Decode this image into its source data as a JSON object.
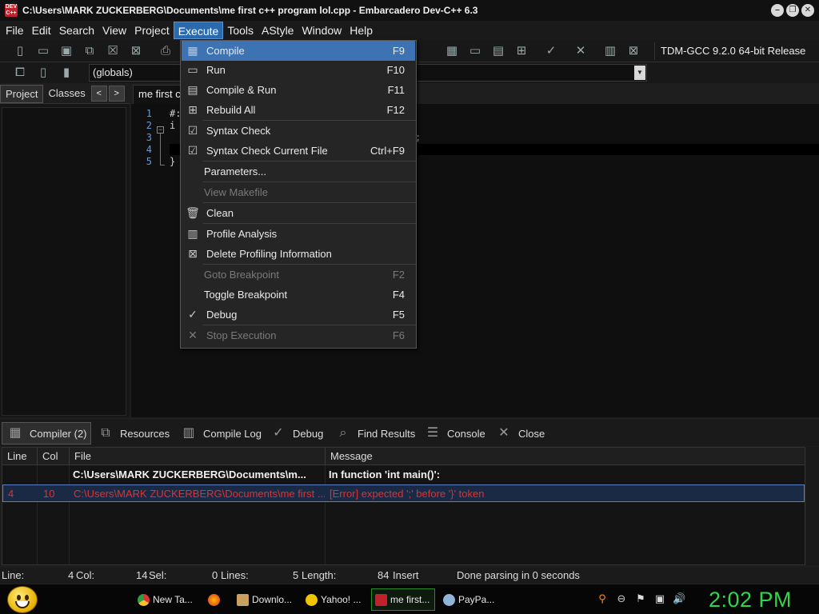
{
  "window": {
    "title": "C:\\Users\\MARK ZUCKERBERG\\Documents\\me first c++ program lol.cpp - Embarcadero Dev-C++ 6.3",
    "app_icon_text": "DEV C++",
    "controls": {
      "minimize": "–",
      "restore": "❐",
      "close": "✕"
    }
  },
  "menubar": {
    "items": [
      "File",
      "Edit",
      "Search",
      "View",
      "Project",
      "Execute",
      "Tools",
      "AStyle",
      "Window",
      "Help"
    ],
    "active_index": 5
  },
  "toolbar": {
    "compiler": "TDM-GCC 9.2.0 64-bit Release",
    "scope": "(globals)"
  },
  "left_panel": {
    "tabs": [
      "Project",
      "Classes"
    ],
    "selected_tab": "Project",
    "prev_arrow": "<",
    "next_arrow": ">"
  },
  "editor": {
    "tab_label": "me first c++ program lol.cpp",
    "line_numbers": [
      "1",
      "2",
      "3",
      "4",
      "5"
    ],
    "code_lines": [
      "#:",
      "i",
      "",
      "",
      "}"
    ],
    "visible_fragment": ";"
  },
  "execute_menu": {
    "items": [
      {
        "label": "Compile",
        "shortcut": "F9",
        "icon": "compile-icon",
        "enabled": true,
        "highlighted": true
      },
      {
        "label": "Run",
        "shortcut": "F10",
        "icon": "run-icon",
        "enabled": true
      },
      {
        "label": "Compile & Run",
        "shortcut": "F11",
        "icon": "compile-run-icon",
        "enabled": true
      },
      {
        "label": "Rebuild All",
        "shortcut": "F12",
        "icon": "rebuild-icon",
        "enabled": true
      },
      {
        "label": "Syntax Check",
        "shortcut": "",
        "icon": "syntax-check-icon",
        "enabled": true
      },
      {
        "label": "Syntax Check Current File",
        "shortcut": "Ctrl+F9",
        "icon": "syntax-check-file-icon",
        "enabled": true
      },
      {
        "label": "Parameters...",
        "shortcut": "",
        "icon": "",
        "enabled": true
      },
      {
        "label": "View Makefile",
        "shortcut": "",
        "icon": "",
        "enabled": false
      },
      {
        "label": "Clean",
        "shortcut": "",
        "icon": "trash-icon",
        "enabled": true
      },
      {
        "label": "Profile Analysis",
        "shortcut": "",
        "icon": "profile-chart-icon",
        "enabled": true
      },
      {
        "label": "Delete Profiling Information",
        "shortcut": "",
        "icon": "delete-profile-icon",
        "enabled": true
      },
      {
        "label": "Goto Breakpoint",
        "shortcut": "F2",
        "icon": "",
        "enabled": false
      },
      {
        "label": "Toggle Breakpoint",
        "shortcut": "F4",
        "icon": "",
        "enabled": true
      },
      {
        "label": "Debug",
        "shortcut": "F5",
        "icon": "debug-check-icon",
        "enabled": true
      },
      {
        "label": "Stop Execution",
        "shortcut": "F6",
        "icon": "stop-icon",
        "enabled": false
      }
    ]
  },
  "bottom_tabs": [
    "Compiler (2)",
    "Resources",
    "Compile Log",
    "Debug",
    "Find Results",
    "Console",
    "Close"
  ],
  "messages": {
    "headers": [
      "Line",
      "Col",
      "File",
      "Message"
    ],
    "rows": [
      {
        "line": "",
        "col": "",
        "file": "C:\\Users\\MARK ZUCKERBERG\\Documents\\m...",
        "message": "In function 'int main()':"
      },
      {
        "line": "4",
        "col": "10",
        "file": "C:\\Users\\MARK ZUCKERBERG\\Documents\\me first ...",
        "message": "[Error] expected ';' before '}' token"
      }
    ]
  },
  "statusbar": {
    "line_label": "Line:",
    "line_value": "4",
    "col_label": "Col:",
    "col_value": "14",
    "sel_label": "Sel:",
    "sel_value": "0",
    "lines_label": "Lines:",
    "lines_value": "5",
    "length_label": "Length:",
    "length_value": "84",
    "mode": "Insert",
    "parse_status": "Done parsing in 0 seconds"
  },
  "taskbar": {
    "tasks": [
      "New Ta...",
      "",
      "Downlo...",
      "Yahoo! ...",
      "me first...",
      "PayPa..."
    ],
    "active_task": "me first...",
    "clock": "2:02 PM"
  },
  "colors": {
    "menu_highlight": "#3d72b3",
    "error_text": "#e03030",
    "clock": "#2ed64a"
  }
}
